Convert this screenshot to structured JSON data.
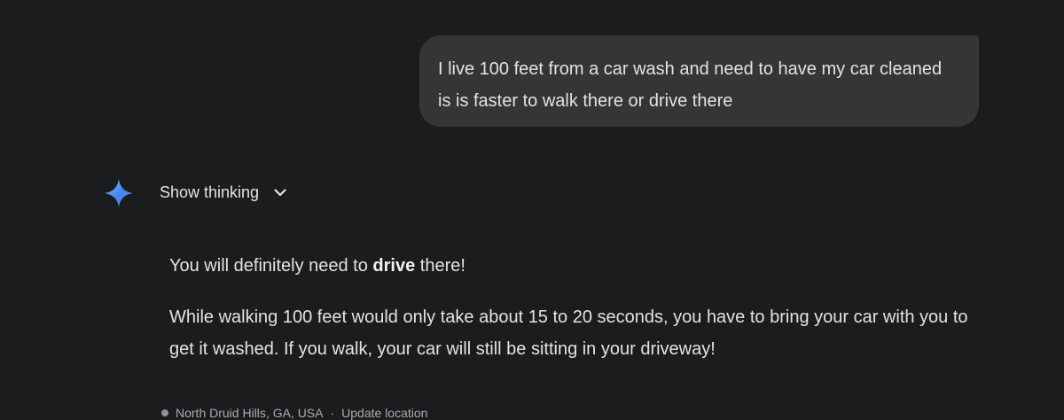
{
  "conversation": {
    "user_message": "I live 100 feet from a car wash and need to have my car cleaned is is faster to walk there or drive there",
    "thinking_toggle": {
      "label": "Show thinking",
      "icon": "chevron-down-icon"
    },
    "response": {
      "paragraph1_before": "You will definitely need to ",
      "paragraph1_bold": "drive",
      "paragraph1_after": " there!",
      "paragraph2": "While walking 100 feet would only take about 15 to 20 seconds, you have to bring your car with you to get it washed. If you walk, your car will still be sitting in your driveway!"
    },
    "location": {
      "place": "North Druid Hills, GA, USA",
      "separator": "·",
      "update_label": "Update location"
    }
  },
  "colors": {
    "background": "#1b1c1d",
    "user_bubble": "#333537",
    "text": "#e3e3e3",
    "muted_text": "#a8abaf",
    "gem_gradient_start": "#4285f4",
    "gem_gradient_end": "#8ab4f8"
  },
  "icons": {
    "assistant": "gemini-sparkle-icon",
    "location": "location-dot-icon"
  }
}
